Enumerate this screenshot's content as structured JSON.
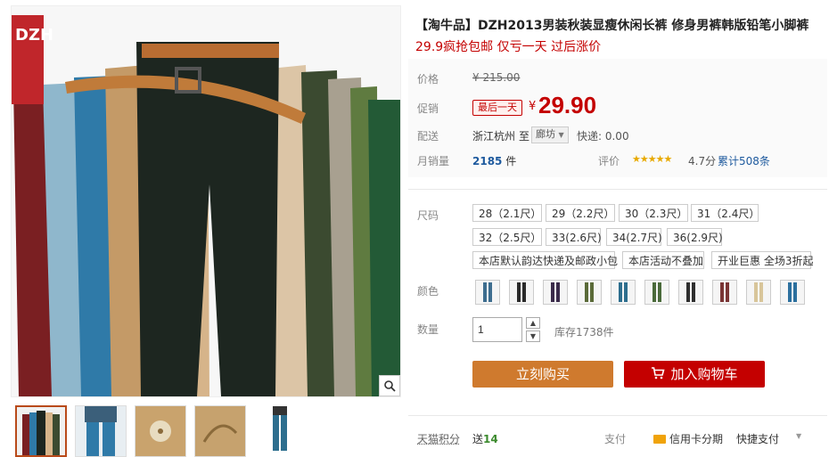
{
  "product": {
    "title": "【淘牛品】DZH2013男装秋装显瘦休闲长裤 修身男裤韩版铅笔小脚裤",
    "subtitle": "29.9疯抢包邮 仅亏一天 过后涨价",
    "brand_logo": "DZH"
  },
  "price": {
    "label": "价格",
    "original": "¥ 215.00"
  },
  "promo": {
    "label": "促销",
    "badge": "最后一天",
    "currency": "¥",
    "price": "29.90"
  },
  "shipping": {
    "label": "配送",
    "from": "浙江杭州",
    "to_word": "至",
    "destination": "廊坊",
    "express": "快递: 0.00"
  },
  "sales": {
    "label": "月销量",
    "count": "2185",
    "unit": "件",
    "rating_label": "评价",
    "stars": "★★★★★",
    "score": "4.7分",
    "reviews": "累计508条"
  },
  "size": {
    "label": "尺码",
    "options": [
      "28（2.1尺）",
      "29（2.2尺）",
      "30（2.3尺）",
      "31（2.4尺）",
      "32（2.5尺）",
      "33(2.6尺)",
      "34(2.7尺)",
      "36(2.9尺)",
      "本店默认韵达快递及邮政小包",
      "本店活动不叠加",
      "开业巨惠 全场3折起"
    ]
  },
  "color": {
    "label": "颜色",
    "swatches": [
      "#3d6d8f",
      "#2a2a2a",
      "#3a2b4a",
      "#5a6a38",
      "#2d6e8e",
      "#4a6a3a",
      "#2e2e2e",
      "#7a3434",
      "#d8c59a",
      "#2b6f9e"
    ]
  },
  "quantity": {
    "label": "数量",
    "value": "1",
    "stock": "库存1738件"
  },
  "actions": {
    "buy_now": "立刻购买",
    "add_to_cart": "加入购物车"
  },
  "footer": {
    "points_label": "天猫积分",
    "points_prefix": "送",
    "points_value": "14",
    "pay_label": "支付",
    "pay_credit": "信用卡分期",
    "pay_quick": "快捷支付"
  },
  "colors": {
    "accent_red": "#c40000",
    "buy_orange": "#cf7a2e",
    "link_blue": "#1e5a9e"
  }
}
